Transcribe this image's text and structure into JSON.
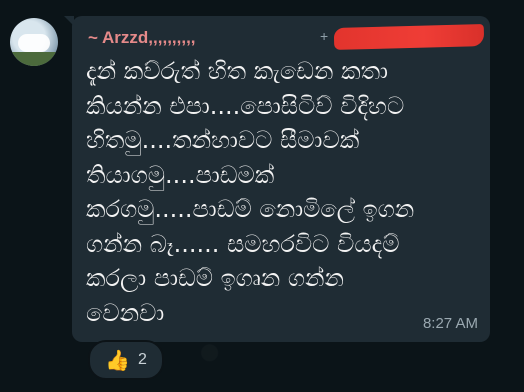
{
  "message": {
    "sender": "~ Arzzd,,,,,,,,,,",
    "phone_prefix": "+",
    "text": "දැන් කව්රුත් හිත කැඩෙන කතා\nකියන්න එපා....පොසිටිව් විදිහට\nහිතමු....තන්හාවට සීමාවක්\nතියාගමු....පාඩමක්\nකරගමු.....පාඩම් නොමිලේ ඉගන\nගන්න බෑ...... සමහරවිට වියදම්\nකරලා පාඩම් ඉග්‍රුන ගන්න\nවෙනවා",
    "time": "8:27 AM"
  },
  "reaction": {
    "emoji": "👍",
    "count": "2"
  },
  "colors": {
    "bubble": "#1f2c34",
    "sender_name": "#e58a8a",
    "redaction": "#e2342d"
  }
}
